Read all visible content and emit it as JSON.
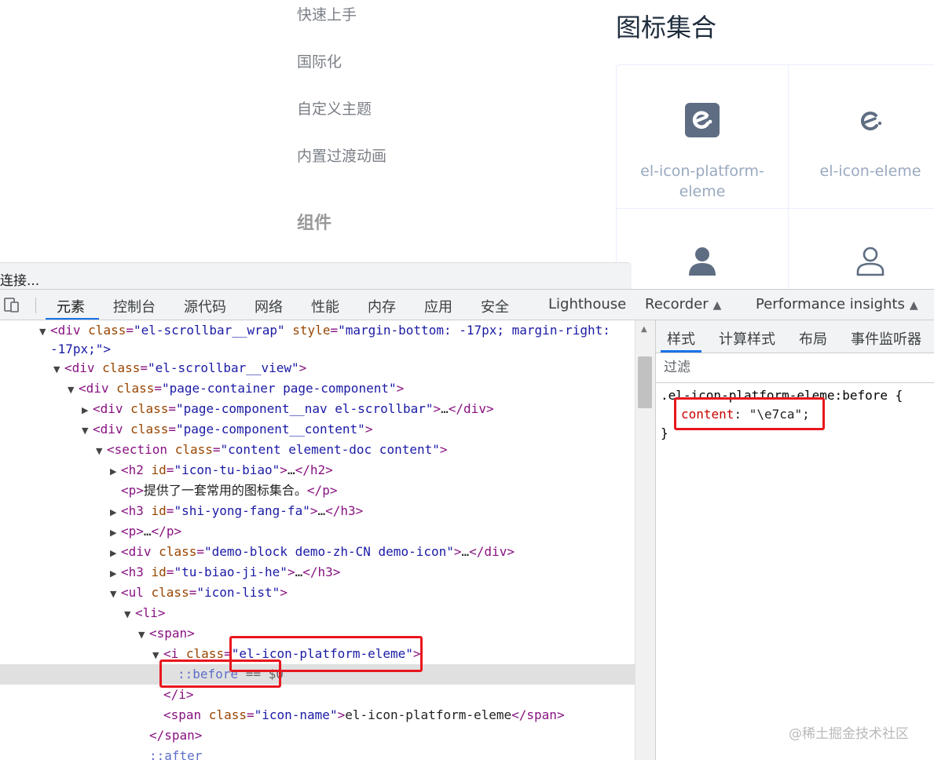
{
  "sidebar": {
    "items": [
      "快速上手",
      "国际化",
      "自定义主题",
      "内置过渡动画"
    ],
    "group_title": "组件"
  },
  "page": {
    "heading": "图标集合",
    "icons": [
      {
        "icon": "element-platform-logo-icon",
        "name_line1": "el-icon-platform-",
        "name_line2": "eleme"
      },
      {
        "icon": "element-logo-icon",
        "name_line1": "el-icon-eleme",
        "name_line2": ""
      },
      {
        "icon": "user-solid-icon",
        "name_line1": "",
        "name_line2": ""
      },
      {
        "icon": "user-outline-icon",
        "name_line1": "",
        "name_line2": ""
      }
    ]
  },
  "devtools": {
    "connect_status": "连接...",
    "tabs": [
      "元素",
      "控制台",
      "源代码",
      "网络",
      "性能",
      "内存",
      "应用",
      "安全",
      "Lighthouse",
      "Recorder",
      "Performance insights"
    ],
    "active_tab": "元素",
    "elements": {
      "r1a": {
        "attr1": "class",
        "val1": "\"el-scrollbar__wrap\"",
        "attr2": "style",
        "val2": "\"margin-bottom: -17px; margin-right:"
      },
      "r1b": "-17px;\">",
      "r2": {
        "attr": "class",
        "val": "\"el-scrollbar__view\""
      },
      "r3": {
        "attr": "class",
        "val": "\"page-container page-component\""
      },
      "r4": {
        "attr": "class",
        "val": "\"page-component__nav el-scrollbar\""
      },
      "r5": {
        "attr": "class",
        "val": "\"page-component__content\""
      },
      "r6": {
        "attr": "class",
        "val": "\"content element-doc content\""
      },
      "r7": {
        "attr": "id",
        "val": "\"icon-tu-biao\""
      },
      "r8": {
        "text": "提供了一套常用的图标集合。"
      },
      "r9": {
        "attr": "id",
        "val": "\"shi-yong-fang-fa\""
      },
      "r11": {
        "attr": "class",
        "val": "\"demo-block demo-zh-CN demo-icon\""
      },
      "r12": {
        "attr": "id",
        "val": "\"tu-biao-ji-he\""
      },
      "r13": {
        "attr": "class",
        "val": "\"icon-list\""
      },
      "r16": {
        "attr": "class",
        "val": "\"el-icon-platform-eleme\""
      },
      "r17": {
        "pseudo": "::before",
        "suffix": " == $0"
      },
      "r19": {
        "attr": "class",
        "val": "\"icon-name\"",
        "text": "el-icon-platform-eleme"
      },
      "r21": {
        "pseudo": "::after"
      }
    },
    "styles": {
      "tabs": [
        "样式",
        "计算样式",
        "布局",
        "事件监听器"
      ],
      "active_tab": "样式",
      "filter_placeholder": "过滤",
      "selector": ".el-icon-platform-eleme:before {",
      "prop_name": "content",
      "prop_value": "\"\\e7ca\";",
      "close_brace": "}"
    }
  },
  "watermark": "@稀土掘金技术社区",
  "colors": {
    "highlight": "#e8161d",
    "tag": "#881280",
    "attr": "#994500",
    "value": "#1a1aa6",
    "active_tab_underline": "#1a73e8"
  }
}
